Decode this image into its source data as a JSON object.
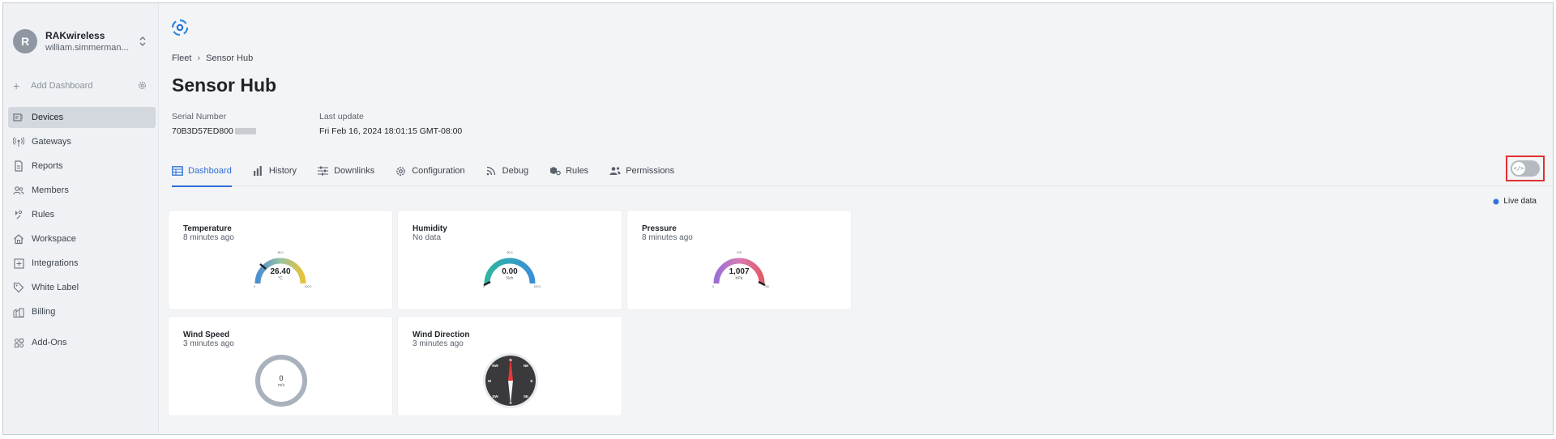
{
  "sidebar": {
    "org_initial": "R",
    "org_name": "RAKwireless",
    "org_user": "william.simmerman...",
    "add_dashboard": "Add Dashboard",
    "items": [
      {
        "label": "Devices",
        "icon": "devices-icon",
        "active": true
      },
      {
        "label": "Gateways",
        "icon": "gateway-icon",
        "active": false
      },
      {
        "label": "Reports",
        "icon": "report-icon",
        "active": false
      },
      {
        "label": "Members",
        "icon": "members-icon",
        "active": false
      },
      {
        "label": "Rules",
        "icon": "rules-icon",
        "active": false
      },
      {
        "label": "Workspace",
        "icon": "workspace-icon",
        "active": false
      },
      {
        "label": "Integrations",
        "icon": "integrations-icon",
        "active": false
      },
      {
        "label": "White Label",
        "icon": "tag-icon",
        "active": false
      },
      {
        "label": "Billing",
        "icon": "billing-icon",
        "active": false
      },
      {
        "label": "Add-Ons",
        "icon": "addons-icon",
        "active": false
      }
    ]
  },
  "breadcrumb": {
    "parent": "Fleet",
    "current": "Sensor Hub"
  },
  "page": {
    "title": "Sensor Hub"
  },
  "device": {
    "serial_label": "Serial Number",
    "serial_value": "70B3D57ED800",
    "update_label": "Last update",
    "update_value": "Fri Feb 16, 2024 18:01:15 GMT-08:00"
  },
  "tabs": [
    {
      "label": "Dashboard",
      "icon": "table-icon",
      "active": true
    },
    {
      "label": "History",
      "icon": "bar-chart-icon",
      "active": false
    },
    {
      "label": "Downlinks",
      "icon": "sliders-icon",
      "active": false
    },
    {
      "label": "Configuration",
      "icon": "gear-icon",
      "active": false
    },
    {
      "label": "Debug",
      "icon": "rss-icon",
      "active": false
    },
    {
      "label": "Rules",
      "icon": "rules-icon",
      "active": false
    },
    {
      "label": "Permissions",
      "icon": "permissions-icon",
      "active": false
    }
  ],
  "toggle": {
    "icon_text": "</>",
    "on": false
  },
  "live_data_label": "Live data",
  "widgets": {
    "temperature": {
      "title": "Temperature",
      "subtitle": "8 minutes ago",
      "value": "26.40",
      "unit": "°C",
      "min": "0",
      "mid": "50.0",
      "max": "100.0"
    },
    "humidity": {
      "title": "Humidity",
      "subtitle": "No data",
      "value": "0.00",
      "unit": "%rh",
      "min": "0",
      "mid": "50.0",
      "max": "100.0"
    },
    "pressure": {
      "title": "Pressure",
      "subtitle": "8 minutes ago",
      "value": "1,007",
      "unit": "hPa",
      "min": "0",
      "mid": "375",
      "max": "750"
    },
    "wind_speed": {
      "title": "Wind Speed",
      "subtitle": "3 minutes ago",
      "value": "0",
      "unit": "m/s"
    },
    "wind_direction": {
      "title": "Wind Direction",
      "subtitle": "3 minutes ago",
      "labels": {
        "n": "N",
        "ne": "NE",
        "e": "E",
        "se": "SE",
        "s": "S",
        "sw": "SW",
        "w": "W",
        "nw": "NW"
      }
    }
  },
  "colors": {
    "accent": "#2f6dd5",
    "highlight_border": "#e03131",
    "sidebar_active": "#d3d7de"
  }
}
